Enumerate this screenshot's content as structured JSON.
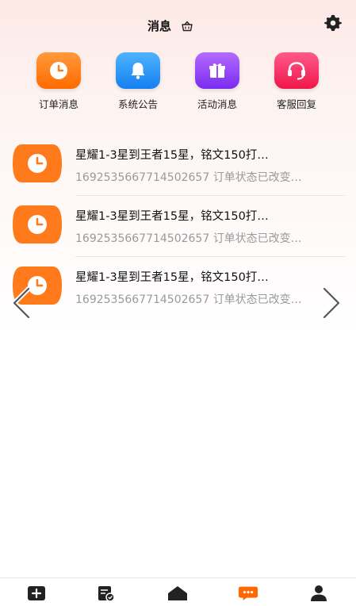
{
  "header": {
    "title": "消息"
  },
  "categories": [
    {
      "label": "订单消息",
      "icon": "clock-icon",
      "color": "#ff7a1a"
    },
    {
      "label": "系统公告",
      "icon": "bell-icon",
      "color": "#1e90ff"
    },
    {
      "label": "活动消息",
      "icon": "gift-icon",
      "color": "#8a3dff"
    },
    {
      "label": "客服回复",
      "icon": "headset-icon",
      "color": "#ff2d55"
    }
  ],
  "messages": [
    {
      "title": "星耀1-3星到王者15星，铭文150打…",
      "subtitle": "1692535667714502657 订单状态已改变…"
    },
    {
      "title": "星耀1-3星到王者15星，铭文150打…",
      "subtitle": "1692535667714502657 订单状态已改变…"
    },
    {
      "title": "星耀1-3星到王者15星，铭文150打…",
      "subtitle": "1692535667714502657 订单状态已改变…"
    }
  ],
  "tabbar": {
    "items": [
      "add-icon",
      "orders-icon",
      "home-icon",
      "messages-icon",
      "profile-icon"
    ],
    "active_color": "#ff6a00"
  }
}
